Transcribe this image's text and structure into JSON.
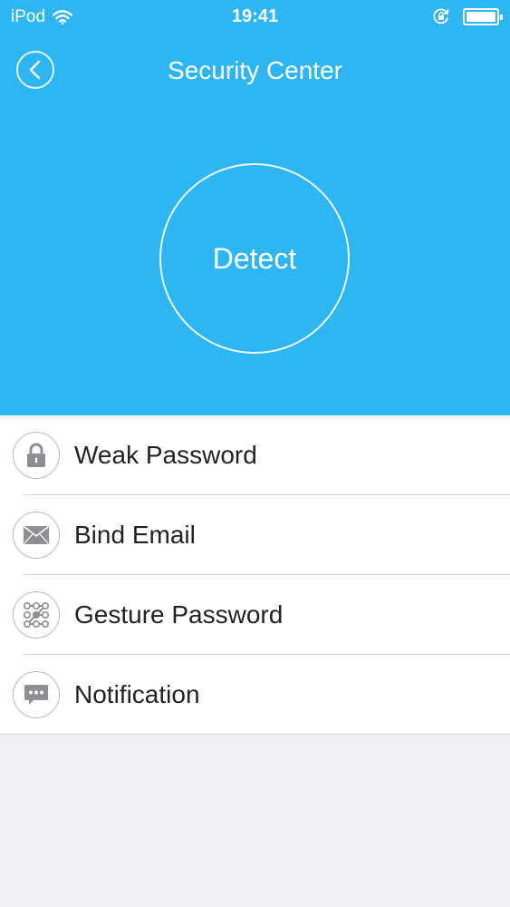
{
  "status_bar": {
    "carrier": "iPod",
    "time": "19:41"
  },
  "nav": {
    "title": "Security Center"
  },
  "detect": {
    "label": "Detect"
  },
  "menu": {
    "items": [
      {
        "label": "Weak Password",
        "icon": "lock-icon"
      },
      {
        "label": "Bind Email",
        "icon": "envelope-icon"
      },
      {
        "label": "Gesture Password",
        "icon": "gesture-pattern-icon"
      },
      {
        "label": "Notification",
        "icon": "message-bubble-icon"
      }
    ]
  },
  "colors": {
    "accent": "#2eb6f3",
    "background": "#efeff4",
    "icon_gray": "#8e8e93"
  }
}
